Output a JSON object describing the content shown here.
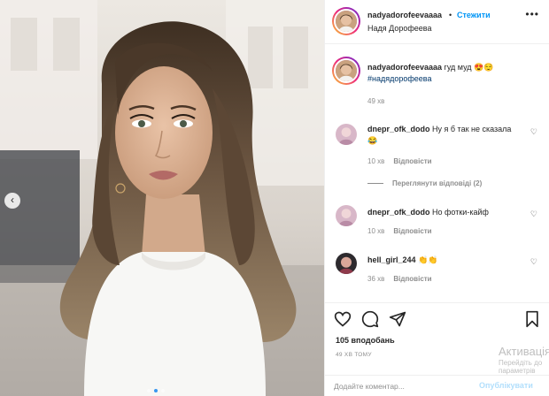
{
  "post": {
    "username": "nadyadorofeevaaaa",
    "separator": "•",
    "follow_label": "Стежити",
    "subtitle": "Надя Дорофеева",
    "more_icon": "more-horizontal-icon"
  },
  "caption": {
    "username": "nadyadorofeevaaaa",
    "text": " гуд муд 😍😌",
    "hashtag": "#надядорофеева",
    "time": "49 хв"
  },
  "comments": [
    {
      "username": "dnepr_ofk_dodo",
      "text": " Ну я б так не сказала 😂",
      "time": "10 хв",
      "reply_label": "Відповісти"
    },
    {
      "username": "dnepr_ofk_dodo",
      "text": " Но фотки-кайф",
      "time": "10 хв",
      "reply_label": "Відповісти"
    },
    {
      "username": "hell_girl_244",
      "text": " 👏👏",
      "time": "36 хв",
      "reply_label": "Відповісти"
    }
  ],
  "view_replies_label": "Переглянути відповіді (2)",
  "actions": {
    "like_icon": "heart-icon",
    "comment_icon": "comment-icon",
    "share_icon": "send-icon",
    "save_icon": "bookmark-icon"
  },
  "likes_label": "105 вподобань",
  "posted_ago": "49 ХВ ТОМУ",
  "add_comment_placeholder": "Додайте коментар...",
  "publish_label": "Опублікувати",
  "watermark": {
    "title": "Активація",
    "subtitle": "Перейдіть до параметрів"
  },
  "carousel": {
    "prev_label": "‹",
    "count": 3,
    "active_index": 1
  }
}
